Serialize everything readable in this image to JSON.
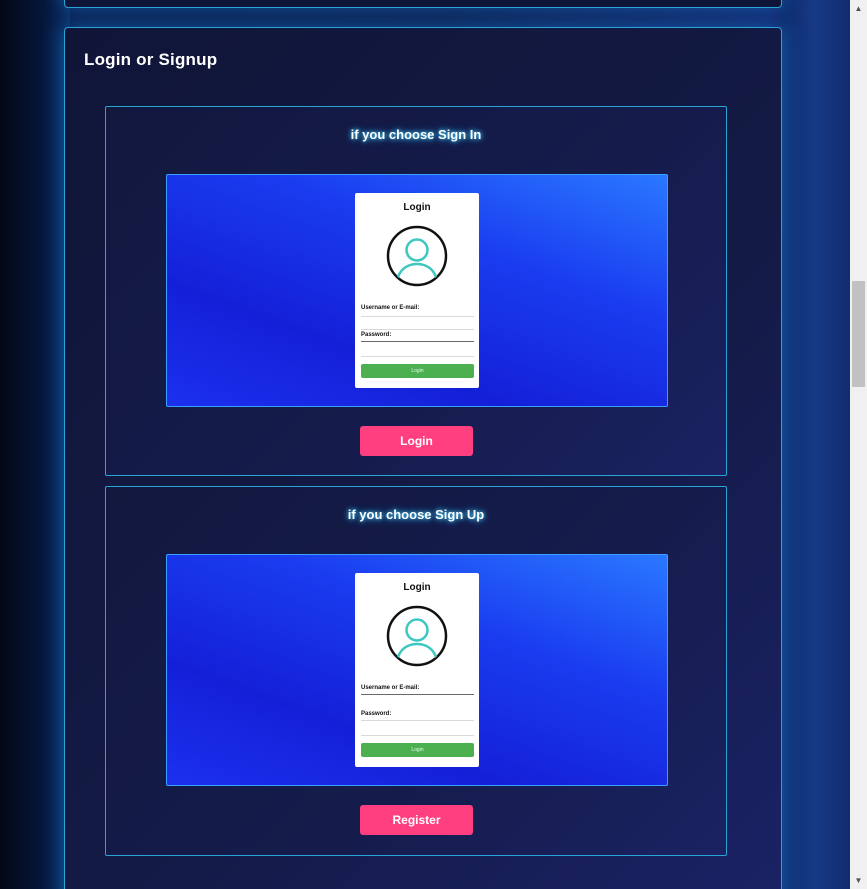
{
  "section": {
    "title": "Login or Signup"
  },
  "options": [
    {
      "heading": "if you choose Sign In",
      "preview": {
        "form_title": "Login",
        "username_label": "Username or E-mail:",
        "password_label": "Password:",
        "button_label": "Login"
      },
      "button_label": "Login"
    },
    {
      "heading": "if you choose Sign Up",
      "preview": {
        "form_title": "Login",
        "username_label": "Username or E-mail:",
        "password_label": "Password:",
        "button_label": "Login"
      },
      "button_label": "Register"
    }
  ],
  "icons": {
    "avatar": "user-avatar-icon",
    "scroll_up": "arrow-up-icon",
    "scroll_down": "arrow-down-icon"
  },
  "colors": {
    "accent_pink": "#ff3f7f",
    "border_cyan": "#2aa3d6",
    "mini_button_green": "#4caf50",
    "avatar_teal": "#3cc8c0"
  }
}
